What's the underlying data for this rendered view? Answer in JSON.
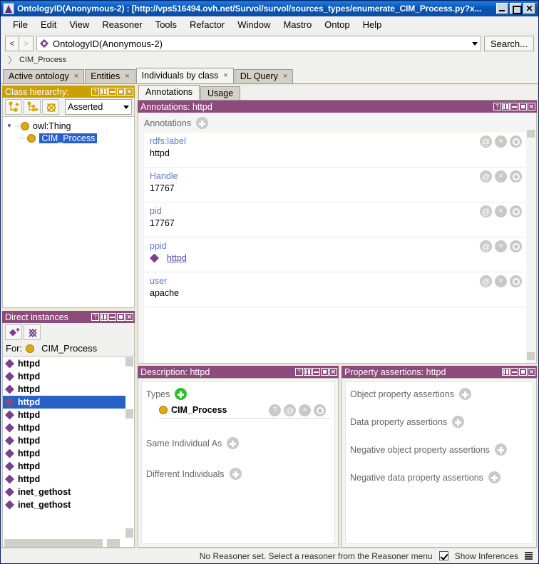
{
  "window": {
    "title": "OntologyID(Anonymous-2) : [http://vps516494.ovh.net/Survol/survol/sources_types/enumerate_CIM_Process.py?x...",
    "minimize_label": "_",
    "maximize_label": "□",
    "close_label": "×",
    "app_icon": "protege-icon"
  },
  "menubar": {
    "items": [
      {
        "label": "File"
      },
      {
        "label": "Edit"
      },
      {
        "label": "View"
      },
      {
        "label": "Reasoner"
      },
      {
        "label": "Tools"
      },
      {
        "label": "Refactor"
      },
      {
        "label": "Window"
      },
      {
        "label": "Mastro"
      },
      {
        "label": "Ontop"
      },
      {
        "label": "Help"
      }
    ]
  },
  "navbar": {
    "back_label": "<",
    "forward_label": ">",
    "ontology_value": "OntologyID(Anonymous-2)",
    "search_label": "Search..."
  },
  "breadcrumb": {
    "separator": "〉",
    "item": "CIM_Process"
  },
  "tabs": [
    {
      "label": "Active ontology",
      "close": "×",
      "active": false
    },
    {
      "label": "Entities",
      "close": "×",
      "active": false
    },
    {
      "label": "Individuals by class",
      "close": "×",
      "active": true
    },
    {
      "label": "DL Query",
      "close": "×",
      "active": false
    }
  ],
  "class_hierarchy": {
    "title": "Class hierarchy:",
    "header_icons": [
      "?",
      "split",
      "minimize",
      "maximize",
      "close"
    ],
    "toolbar": [
      {
        "name": "add-subclass-button"
      },
      {
        "name": "add-sibling-class-button"
      },
      {
        "name": "delete-class-button"
      }
    ],
    "reasoner_mode": "Asserted",
    "tree": [
      {
        "label": "owl:Thing",
        "selected": false,
        "indent": 0,
        "expander": "▼"
      },
      {
        "label": "CIM_Process",
        "selected": true,
        "indent": 1,
        "expander": ""
      }
    ]
  },
  "direct_instances": {
    "title": "Direct instances",
    "header_icons": [
      "?",
      "split",
      "minimize",
      "maximize",
      "close"
    ],
    "toolbar": [
      {
        "name": "add-individual-button"
      },
      {
        "name": "delete-individual-button"
      }
    ],
    "for_label": "For:",
    "for_class": "CIM_Process",
    "items": [
      {
        "label": "httpd",
        "selected": false
      },
      {
        "label": "httpd",
        "selected": false
      },
      {
        "label": "httpd",
        "selected": false
      },
      {
        "label": "httpd",
        "selected": true
      },
      {
        "label": "httpd",
        "selected": false
      },
      {
        "label": "httpd",
        "selected": false
      },
      {
        "label": "httpd",
        "selected": false
      },
      {
        "label": "httpd",
        "selected": false
      },
      {
        "label": "httpd",
        "selected": false
      },
      {
        "label": "httpd",
        "selected": false
      },
      {
        "label": "inet_gethost",
        "selected": false
      },
      {
        "label": "inet_gethost",
        "selected": false
      }
    ]
  },
  "inner_tabs": [
    {
      "label": "Annotations",
      "active": true
    },
    {
      "label": "Usage",
      "active": false
    }
  ],
  "annotations_panel": {
    "title": "Annotations: httpd",
    "header_icons": [
      "?",
      "split",
      "minimize",
      "maximize",
      "close"
    ],
    "section_label": "Annotations",
    "rows": [
      {
        "property": "rdfs:label",
        "value": "httpd",
        "is_link": false,
        "actions": [
          "@",
          "×",
          "o"
        ]
      },
      {
        "property": "Handle",
        "value": "17767",
        "is_link": false,
        "actions": [
          "@",
          "×",
          "o"
        ]
      },
      {
        "property": "pid",
        "value": "17767",
        "is_link": false,
        "actions": [
          "@",
          "×",
          "o"
        ]
      },
      {
        "property": "ppid",
        "value": "httpd",
        "is_link": true,
        "actions": [
          "@",
          "×",
          "o"
        ]
      },
      {
        "property": "user",
        "value": "apache",
        "is_link": false,
        "actions": [
          "@",
          "×",
          "o"
        ]
      }
    ]
  },
  "description_panel": {
    "title": "Description: httpd",
    "header_icons": [
      "?",
      "split",
      "minimize",
      "maximize",
      "close"
    ],
    "types_label": "Types",
    "type_value": "CIM_Process",
    "type_actions": [
      "?",
      "@",
      "×",
      "o"
    ],
    "same_individual_label": "Same Individual As",
    "different_individuals_label": "Different Individuals"
  },
  "property_assertions_panel": {
    "title": "Property assertions: httpd",
    "header_icons": [
      "split",
      "minimize",
      "maximize",
      "close"
    ],
    "sections": [
      {
        "label": "Object property assertions"
      },
      {
        "label": "Data property assertions"
      },
      {
        "label": "Negative object property assertions"
      },
      {
        "label": "Negative data property assertions"
      }
    ]
  },
  "statusbar": {
    "reasoner_text": "No Reasoner set. Select a reasoner from the Reasoner menu",
    "show_inferences_label": "Show Inferences",
    "show_inferences_checked": true
  },
  "colors": {
    "title_blue": "#0b54ae",
    "gold": "#caa005",
    "purple": "#8d4a7d",
    "link_blue": "#5b7ec9",
    "selection_blue": "#2862c8",
    "individual_purple": "#7b3f8f",
    "class_gold_dot": "#e0a911",
    "green_plus": "#2cc12c"
  }
}
